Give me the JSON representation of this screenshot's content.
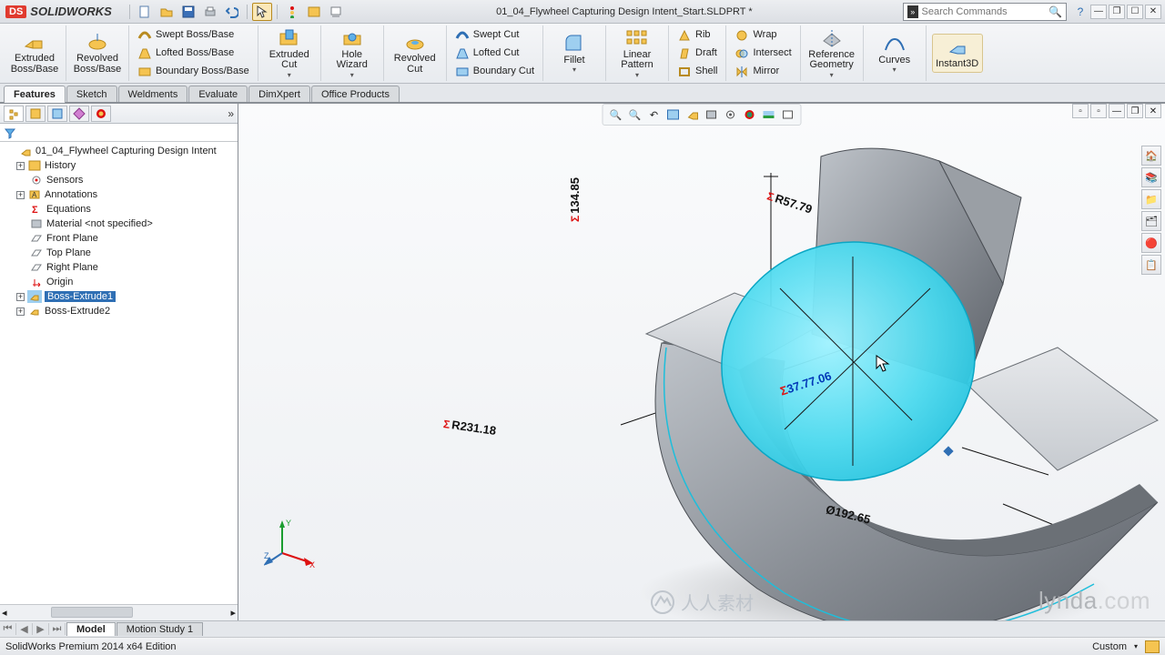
{
  "title": "01_04_Flywheel Capturing Design Intent_Start.SLDPRT *",
  "brand": "SOLIDWORKS",
  "search": {
    "placeholder": "Search Commands"
  },
  "ribbon": {
    "extrudedBoss": "Extruded Boss/Base",
    "revolvedBoss": "Revolved Boss/Base",
    "sweptBoss": "Swept Boss/Base",
    "loftedBoss": "Lofted Boss/Base",
    "boundaryBoss": "Boundary Boss/Base",
    "extrudedCut": "Extruded Cut",
    "holeWizard": "Hole Wizard",
    "revolvedCut": "Revolved Cut",
    "sweptCut": "Swept Cut",
    "loftedCut": "Lofted Cut",
    "boundaryCut": "Boundary Cut",
    "fillet": "Fillet",
    "linearPattern": "Linear Pattern",
    "rib": "Rib",
    "draft": "Draft",
    "shell": "Shell",
    "wrap": "Wrap",
    "intersect": "Intersect",
    "mirror": "Mirror",
    "refGeom": "Reference Geometry",
    "curves": "Curves",
    "instant3d": "Instant3D"
  },
  "tabs": {
    "features": "Features",
    "sketch": "Sketch",
    "weldments": "Weldments",
    "evaluate": "Evaluate",
    "dimxpert": "DimXpert",
    "office": "Office Products"
  },
  "tree": {
    "root": "01_04_Flywheel Capturing Design Intent",
    "history": "History",
    "sensors": "Sensors",
    "annotations": "Annotations",
    "equations": "Equations",
    "material": "Material <not specified>",
    "front": "Front Plane",
    "top": "Top Plane",
    "right": "Right Plane",
    "origin": "Origin",
    "be1": "Boss-Extrude1",
    "be2": "Boss-Extrude2"
  },
  "dims": {
    "d134": "134.85",
    "r57": "R57.79",
    "r231": "R231.18",
    "d192": "Ø192.65",
    "d77": "37.77.06"
  },
  "bottomTabs": {
    "model": "Model",
    "motion": "Motion Study 1"
  },
  "status": {
    "edition": "SolidWorks Premium 2014 x64 Edition",
    "custom": "Custom"
  },
  "watermark": {
    "brand": "lynda",
    "dom": ".com",
    "cn": "人人素材"
  }
}
